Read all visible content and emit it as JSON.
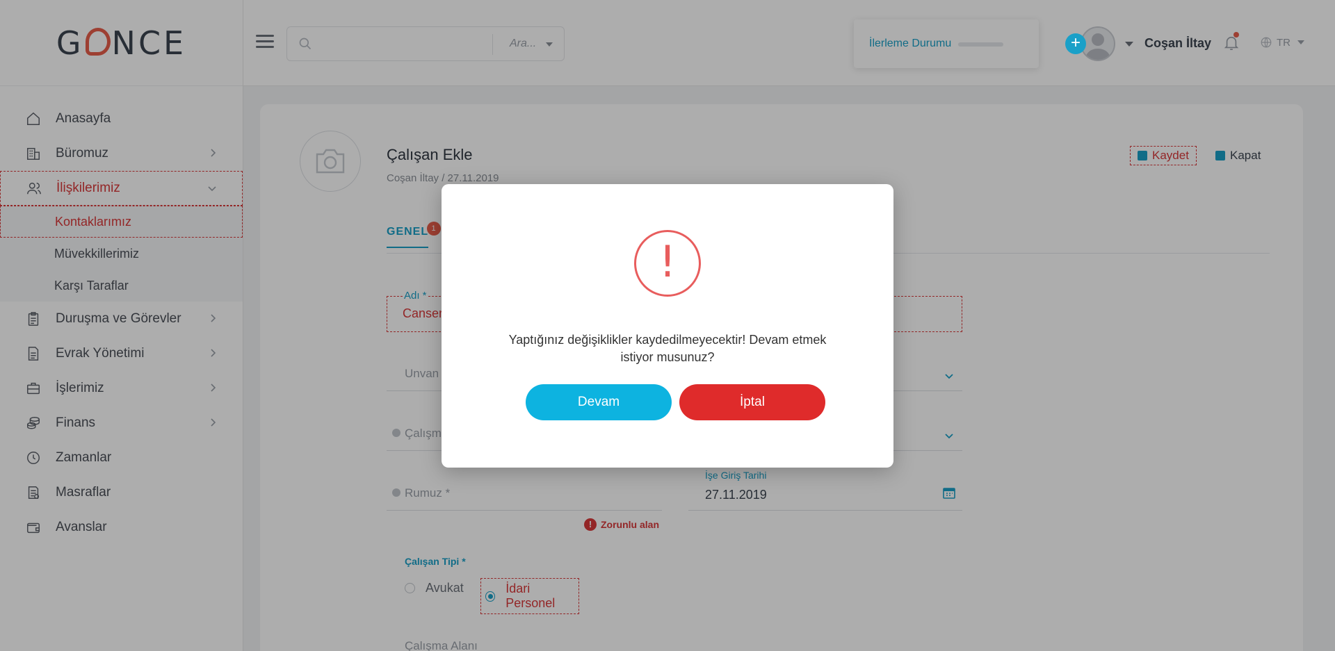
{
  "brand": {
    "logo_text": "GÜNCE"
  },
  "sidebar": {
    "items": [
      {
        "label": "Anasayfa",
        "icon": "home-icon",
        "has_children": false
      },
      {
        "label": "Büromuz",
        "icon": "building-icon",
        "has_children": true
      },
      {
        "label": "İlişkilerimiz",
        "icon": "users-icon",
        "has_children": true,
        "expanded": true,
        "active": true
      },
      {
        "label": "Duruşma ve Görevler",
        "icon": "clipboard-icon",
        "has_children": true
      },
      {
        "label": "Evrak Yönetimi",
        "icon": "document-icon",
        "has_children": true
      },
      {
        "label": "İşlerimiz",
        "icon": "briefcase-icon",
        "has_children": true
      },
      {
        "label": "Finans",
        "icon": "coins-icon",
        "has_children": true
      },
      {
        "label": "Zamanlar",
        "icon": "clock-icon",
        "has_children": false
      },
      {
        "label": "Masraflar",
        "icon": "receipt-icon",
        "has_children": false
      },
      {
        "label": "Avanslar",
        "icon": "wallet-icon",
        "has_children": false
      }
    ],
    "subitems": [
      {
        "label": "Kontaklarımız",
        "active": true
      },
      {
        "label": "Müvekkillerimiz",
        "active": false
      },
      {
        "label": "Karşı Taraflar",
        "active": false
      }
    ]
  },
  "header": {
    "search": {
      "placeholder": "",
      "scope_label": "Ara..."
    },
    "progress": {
      "label": "İlerleme Durumu",
      "value": 0
    },
    "user_name": "Coşan İltay",
    "language": "TR",
    "add_label": "+"
  },
  "form": {
    "title": "Çalışan Ekle",
    "subtitle": "Coşan İltay / 27.11.2019",
    "save_label": "Kaydet",
    "close_label": "Kapat",
    "tabs": [
      {
        "label": "GENEL",
        "badge": "1"
      }
    ],
    "name_label": "Adı *",
    "name_value": "Canser",
    "title_placeholder": "Unvan",
    "work_placeholder": "Çalışma",
    "alias_placeholder": "Rumuz *",
    "required_error": "Zorunlu alan",
    "start_date_label": "İşe Giriş Tarihi",
    "start_date_value": "27.11.2019",
    "employee_type_label": "Çalışan Tipi *",
    "employee_types": [
      {
        "label": "Avukat",
        "selected": false
      },
      {
        "label": "İdari Personel",
        "selected": true
      }
    ],
    "work_area_label": "Çalışma Alanı"
  },
  "modal": {
    "icon": "exclamation-icon",
    "message": "Yaptığınız değişiklikler kaydedilmeyecektir! Devam etmek istiyor musunuz?",
    "continue_label": "Devam",
    "cancel_label": "İptal"
  },
  "colors": {
    "accent": "#1aa0c8",
    "danger": "#d9393a",
    "continue_button": "#0db3e0",
    "cancel_button": "#df2b2b"
  }
}
